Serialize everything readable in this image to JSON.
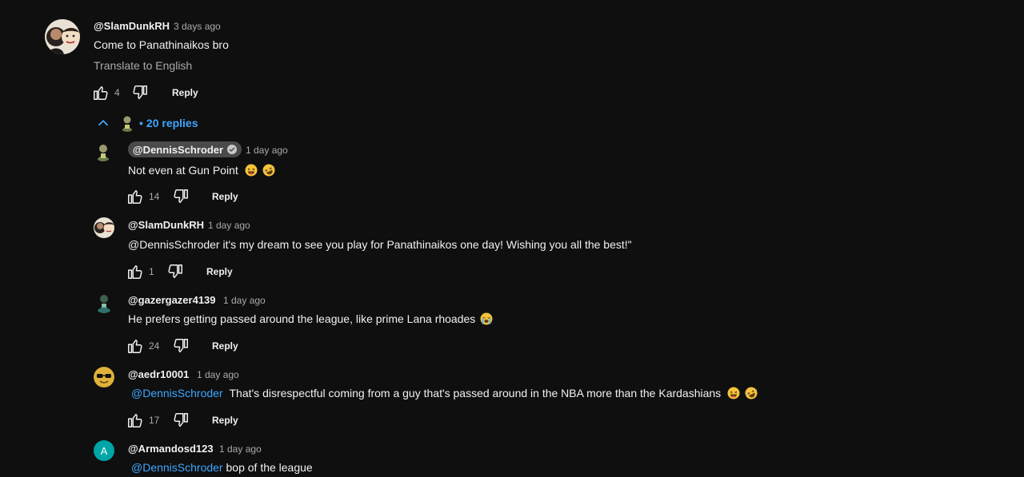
{
  "top_comment": {
    "handle": "@SlamDunkRH",
    "time": "3 days ago",
    "text": "Come to Panathinaikos bro",
    "translate_label": "Translate to English",
    "likes": "4",
    "reply_label": "Reply",
    "replies_toggle": "20 replies"
  },
  "replies": [
    {
      "handle": "@DennisSchroder",
      "time": "1 day ago",
      "text": "Not even at Gun Point",
      "likes": "14",
      "reply_label": "Reply"
    },
    {
      "handle": "@SlamDunkRH",
      "time": "1 day ago",
      "text": "@DennisSchroder  it's my dream to see you play for Panathinaikos one day! Wishing you all the best!\"",
      "likes": "1",
      "reply_label": "Reply"
    },
    {
      "handle": "@gazergazer4139",
      "time": "1 day ago",
      "text": "He prefers getting passed around the league, like prime Lana rhoades",
      "likes": "24",
      "reply_label": "Reply"
    },
    {
      "handle": "@aedr10001",
      "time": "1 day ago",
      "mention": "@DennisSchroder",
      "text": "That's disrespectful coming from a guy that's passed around in the NBA more than the Kardashians",
      "likes": "17",
      "reply_label": "Reply"
    },
    {
      "handle": "@Armandosd123",
      "time": "1 day ago",
      "avatar_letter": "A",
      "mention": "@DennisSchroder",
      "text": "bop of the league"
    }
  ],
  "colors": {
    "background": "#0f0f0f",
    "text": "#f1f1f1",
    "muted": "#aaaaaa",
    "link": "#3ea6ff",
    "avatar_a": "#00a5a8"
  },
  "icons": {
    "like": "thumbs-up-icon",
    "dislike": "thumbs-down-icon",
    "collapse": "chevron-up-icon",
    "verified": "verified-check-icon",
    "laugh": "grinning-squinting-face-emoji",
    "rofl": "rolling-on-floor-laughing-emoji",
    "cry": "loudly-crying-face-emoji"
  }
}
